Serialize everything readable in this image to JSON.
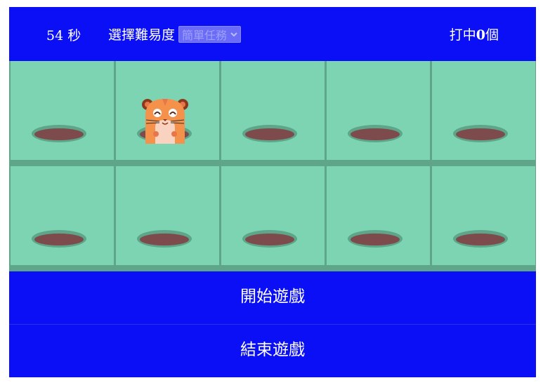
{
  "header": {
    "timer_text": "54 秒",
    "difficulty_label": "選擇難易度",
    "difficulty_selected": "簡單任務",
    "score_prefix": "打中",
    "score_value": "0",
    "score_suffix": "個"
  },
  "board": {
    "rows": 2,
    "columns": 5,
    "mole_cell_index": 1
  },
  "buttons": {
    "start_label": "開始遊戲",
    "end_label": "結束遊戲"
  },
  "colors": {
    "bar_blue": "#0a0ff5",
    "grass": "#7dd4b3",
    "grid_lines": "#5ea58a",
    "hole": "#7d4b4b",
    "mole": "#f4914a"
  },
  "icons": {
    "select_arrow": "chevron-down-icon",
    "character": "hamster-mole"
  }
}
